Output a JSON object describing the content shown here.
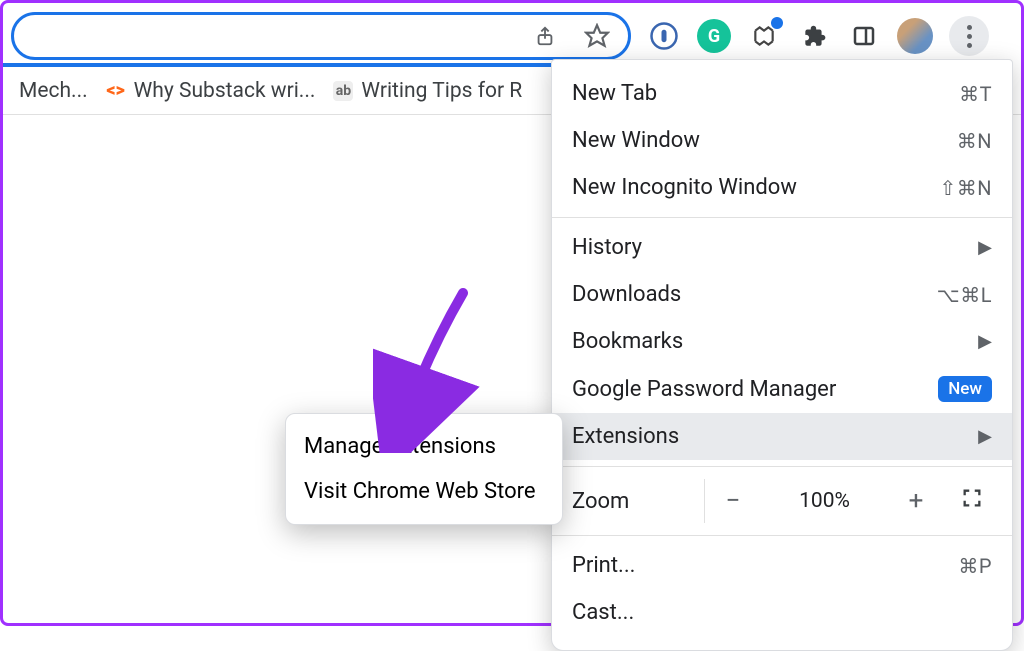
{
  "toolbar": {
    "icons": {
      "share": "share-icon",
      "star": "star-icon",
      "extensions_puzzle": "puzzle-icon",
      "panel": "sidepanel-icon",
      "menu": "kebab-menu-icon"
    }
  },
  "bookmarks": [
    {
      "label": "Mech...",
      "icon": ""
    },
    {
      "label": "Why Substack wri...",
      "icon": "sub"
    },
    {
      "label": "Writing Tips for R",
      "icon": "ab"
    }
  ],
  "menu": {
    "new_tab": {
      "label": "New Tab",
      "shortcut": "⌘T"
    },
    "new_window": {
      "label": "New Window",
      "shortcut": "⌘N"
    },
    "incognito": {
      "label": "New Incognito Window",
      "shortcut": "⇧⌘N"
    },
    "history": {
      "label": "History"
    },
    "downloads": {
      "label": "Downloads",
      "shortcut": "⌥⌘L"
    },
    "bookmarks": {
      "label": "Bookmarks"
    },
    "password_mgr": {
      "label": "Google Password Manager",
      "badge": "New"
    },
    "extensions": {
      "label": "Extensions"
    },
    "zoom": {
      "label": "Zoom",
      "value": "100%"
    },
    "print": {
      "label": "Print...",
      "shortcut": "⌘P"
    },
    "cast": {
      "label": "Cast..."
    }
  },
  "submenu": {
    "manage": "Manage Extensions",
    "webstore": "Visit Chrome Web Store"
  }
}
